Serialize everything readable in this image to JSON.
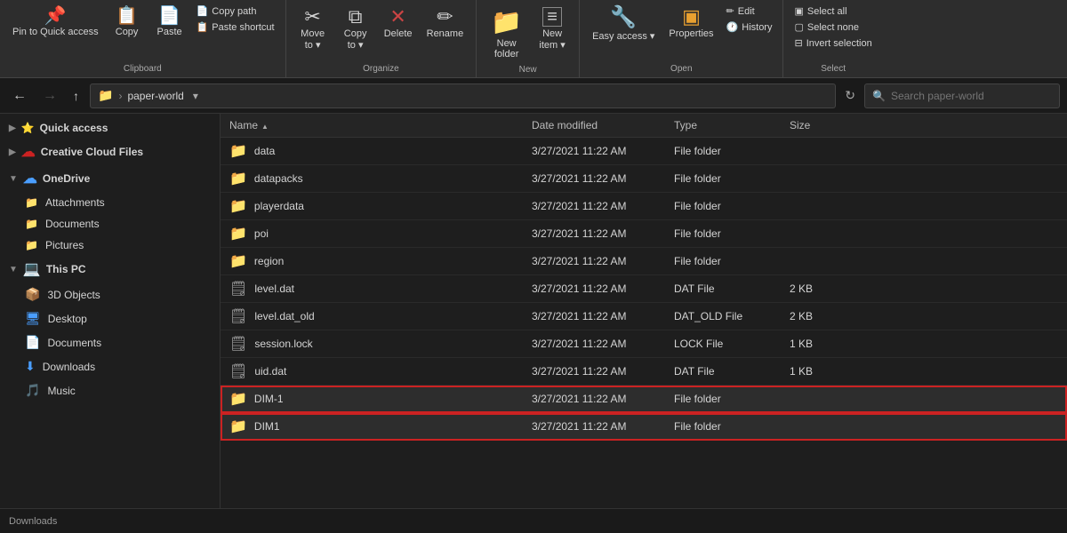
{
  "ribbon": {
    "groups": [
      {
        "label": "Clipboard",
        "items": [
          {
            "id": "pin",
            "icon": "📌",
            "label": "Pin to Quick\naccess",
            "type": "large"
          },
          {
            "id": "copy",
            "icon": "📋",
            "label": "Copy",
            "type": "large"
          },
          {
            "id": "paste",
            "icon": "📄",
            "label": "Paste",
            "type": "large"
          },
          {
            "id": "copypath",
            "icon": "📄",
            "label": "Copy path",
            "type": "small"
          },
          {
            "id": "pasteshortcut",
            "icon": "📋",
            "label": "Paste shortcut",
            "type": "small"
          }
        ]
      },
      {
        "label": "Organize",
        "items": [
          {
            "id": "moveto",
            "icon": "✂",
            "label": "Move\nto ▾",
            "type": "large"
          },
          {
            "id": "copyto",
            "icon": "⧉",
            "label": "Copy\nto ▾",
            "type": "large"
          },
          {
            "id": "delete",
            "icon": "✕",
            "label": "Delete",
            "type": "large"
          },
          {
            "id": "rename",
            "icon": "✏",
            "label": "Rename",
            "type": "large"
          }
        ]
      },
      {
        "label": "New",
        "items": [
          {
            "id": "newfolder",
            "icon": "📁",
            "label": "New\nfolder",
            "type": "large"
          },
          {
            "id": "newitem",
            "icon": "≡",
            "label": "New\nitem ▾",
            "type": "large"
          }
        ]
      },
      {
        "label": "Open",
        "items": [
          {
            "id": "easyaccess",
            "icon": "🔧",
            "label": "Easy access ▾",
            "type": "large"
          },
          {
            "id": "properties",
            "icon": "▣",
            "label": "Properties",
            "type": "large"
          },
          {
            "id": "edit",
            "icon": "✏",
            "label": "Edit",
            "type": "small"
          },
          {
            "id": "history",
            "icon": "🕐",
            "label": "History",
            "type": "small"
          }
        ]
      },
      {
        "label": "Select",
        "items": [
          {
            "id": "selectall",
            "icon": "▣",
            "label": "Select all",
            "type": "small"
          },
          {
            "id": "selectnone",
            "icon": "▢",
            "label": "Select none",
            "type": "small"
          },
          {
            "id": "invert",
            "icon": "⊟",
            "label": "Invert selection",
            "type": "small"
          }
        ]
      }
    ]
  },
  "addressbar": {
    "back_tooltip": "Back",
    "forward_tooltip": "Forward",
    "up_tooltip": "Up",
    "path_icon": "📁",
    "path_text": "paper-world",
    "search_placeholder": "Search paper-world"
  },
  "sidebar": {
    "sections": [
      {
        "id": "quickaccess",
        "icon": "⭐",
        "icon_color": "#4a9eff",
        "label": "Quick access",
        "expanded": true
      },
      {
        "id": "creativecloud",
        "icon": "☁",
        "icon_color": "#cc0000",
        "label": "Creative Cloud Files",
        "expanded": false
      },
      {
        "id": "onedrive",
        "icon": "☁",
        "icon_color": "#4a9eff",
        "label": "OneDrive",
        "expanded": true,
        "children": [
          {
            "id": "attachments",
            "icon": "📁",
            "label": "Attachments"
          },
          {
            "id": "documents",
            "icon": "📁",
            "label": "Documents"
          },
          {
            "id": "pictures",
            "icon": "📁",
            "label": "Pictures"
          }
        ]
      },
      {
        "id": "thispc",
        "icon": "💻",
        "icon_color": "#4a9eff",
        "label": "This PC",
        "expanded": true,
        "children": [
          {
            "id": "3dobjects",
            "icon": "📦",
            "icon_color": "#4a9eff",
            "label": "3D Objects"
          },
          {
            "id": "desktop",
            "icon": "🖥",
            "icon_color": "#4a9eff",
            "label": "Desktop"
          },
          {
            "id": "documents2",
            "icon": "📄",
            "icon_color": "#4a9eff",
            "label": "Documents"
          },
          {
            "id": "downloads",
            "icon": "⬇",
            "icon_color": "#4a9eff",
            "label": "Downloads"
          },
          {
            "id": "music",
            "icon": "🎵",
            "icon_color": "#4a9eff",
            "label": "Music"
          }
        ]
      }
    ]
  },
  "fileList": {
    "columns": [
      {
        "id": "name",
        "label": "Name"
      },
      {
        "id": "date",
        "label": "Date modified"
      },
      {
        "id": "type",
        "label": "Type"
      },
      {
        "id": "size",
        "label": "Size"
      }
    ],
    "files": [
      {
        "id": "data",
        "name": "data",
        "icon": "📁",
        "iconType": "folder",
        "date": "3/27/2021 11:22 AM",
        "type": "File folder",
        "size": ""
      },
      {
        "id": "datapacks",
        "name": "datapacks",
        "icon": "📁",
        "iconType": "folder",
        "date": "3/27/2021 11:22 AM",
        "type": "File folder",
        "size": ""
      },
      {
        "id": "playerdata",
        "name": "playerdata",
        "icon": "📁",
        "iconType": "folder",
        "date": "3/27/2021 11:22 AM",
        "type": "File folder",
        "size": ""
      },
      {
        "id": "poi",
        "name": "poi",
        "icon": "📁",
        "iconType": "folder",
        "date": "3/27/2021 11:22 AM",
        "type": "File folder",
        "size": ""
      },
      {
        "id": "region",
        "name": "region",
        "icon": "📁",
        "iconType": "folder",
        "date": "3/27/2021 11:22 AM",
        "type": "File folder",
        "size": ""
      },
      {
        "id": "leveldat",
        "name": "level.dat",
        "icon": "🗒",
        "iconType": "file",
        "date": "3/27/2021 11:22 AM",
        "type": "DAT File",
        "size": "2 KB"
      },
      {
        "id": "leveldatold",
        "name": "level.dat_old",
        "icon": "🗒",
        "iconType": "file",
        "date": "3/27/2021 11:22 AM",
        "type": "DAT_OLD File",
        "size": "2 KB"
      },
      {
        "id": "sessionlock",
        "name": "session.lock",
        "icon": "🗒",
        "iconType": "file",
        "date": "3/27/2021 11:22 AM",
        "type": "LOCK File",
        "size": "1 KB"
      },
      {
        "id": "uiddat",
        "name": "uid.dat",
        "icon": "🗒",
        "iconType": "file",
        "date": "3/27/2021 11:22 AM",
        "type": "DAT File",
        "size": "1 KB"
      },
      {
        "id": "dim-1",
        "name": "DIM-1",
        "icon": "📁",
        "iconType": "folder",
        "date": "3/27/2021 11:22 AM",
        "type": "File folder",
        "size": "",
        "highlighted": true
      },
      {
        "id": "dim1",
        "name": "DIM1",
        "icon": "📁",
        "iconType": "folder",
        "date": "3/27/2021 11:22 AM",
        "type": "File folder",
        "size": "",
        "highlighted": true
      }
    ]
  },
  "statusBar": {
    "text": "Downloads"
  },
  "colors": {
    "folder": "#f0c040",
    "highlight_border": "#cc2222",
    "accent": "#4a9eff"
  }
}
